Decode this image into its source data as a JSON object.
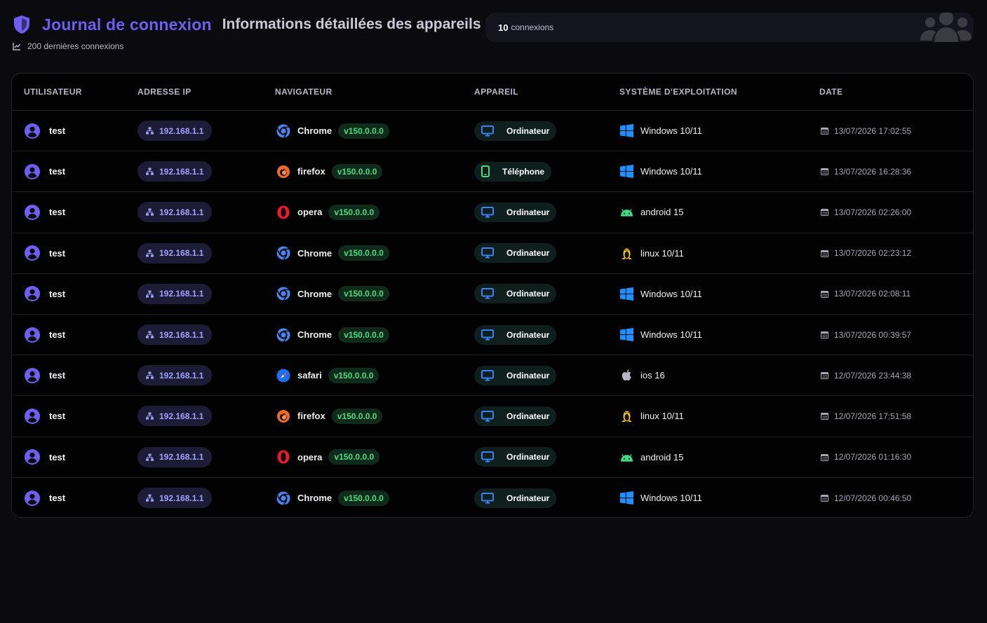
{
  "header": {
    "title": "Journal de connexion",
    "subtitle": "Informations détaillées des appareils",
    "count_value": "10",
    "count_label": "connexions",
    "recent_label": "200 dernières connexions",
    "accent_color": "#6f5ff0"
  },
  "table": {
    "columns": [
      "UTILISATEUR",
      "ADRESSE IP",
      "NAVIGATEUR",
      "APPAREIL",
      "SYSTÈME D'EXPLOITATION",
      "DATE"
    ],
    "rows": [
      {
        "user": "test",
        "ip": "192.168.1.1",
        "browser": "Chrome",
        "browser_icon": "chrome-icon",
        "version": "v150.0.0.0",
        "device": "Ordinateur",
        "device_icon": "desktop-icon",
        "os": "Windows 10/11",
        "os_icon": "windows-icon",
        "date": "13/07/2026 17:02:55"
      },
      {
        "user": "test",
        "ip": "192.168.1.1",
        "browser": "firefox",
        "browser_icon": "firefox-icon",
        "version": "v150.0.0.0",
        "device": "Téléphone",
        "device_icon": "phone-icon",
        "os": "Windows 10/11",
        "os_icon": "windows-icon",
        "date": "13/07/2026 16:28:36"
      },
      {
        "user": "test",
        "ip": "192.168.1.1",
        "browser": "opera",
        "browser_icon": "opera-icon",
        "version": "v150.0.0.0",
        "device": "Ordinateur",
        "device_icon": "desktop-icon",
        "os": "android 15",
        "os_icon": "android-icon",
        "date": "13/07/2026 02:26:00"
      },
      {
        "user": "test",
        "ip": "192.168.1.1",
        "browser": "Chrome",
        "browser_icon": "chrome-icon",
        "version": "v150.0.0.0",
        "device": "Ordinateur",
        "device_icon": "desktop-icon",
        "os": "linux 10/11",
        "os_icon": "linux-icon",
        "date": "13/07/2026 02:23:12"
      },
      {
        "user": "test",
        "ip": "192.168.1.1",
        "browser": "Chrome",
        "browser_icon": "chrome-icon",
        "version": "v150.0.0.0",
        "device": "Ordinateur",
        "device_icon": "desktop-icon",
        "os": "Windows 10/11",
        "os_icon": "windows-icon",
        "date": "13/07/2026 02:08:11"
      },
      {
        "user": "test",
        "ip": "192.168.1.1",
        "browser": "Chrome",
        "browser_icon": "chrome-icon",
        "version": "v150.0.0.0",
        "device": "Ordinateur",
        "device_icon": "desktop-icon",
        "os": "Windows 10/11",
        "os_icon": "windows-icon",
        "date": "13/07/2026 00:39:57"
      },
      {
        "user": "test",
        "ip": "192.168.1.1",
        "browser": "safari",
        "browser_icon": "safari-icon",
        "version": "v150.0.0.0",
        "device": "Ordinateur",
        "device_icon": "desktop-icon",
        "os": "ios 16",
        "os_icon": "apple-icon",
        "date": "12/07/2026 23:44:38"
      },
      {
        "user": "test",
        "ip": "192.168.1.1",
        "browser": "firefox",
        "browser_icon": "firefox-icon",
        "version": "v150.0.0.0",
        "device": "Ordinateur",
        "device_icon": "desktop-icon",
        "os": "linux 10/11",
        "os_icon": "linux-icon",
        "date": "12/07/2026 17:51:58"
      },
      {
        "user": "test",
        "ip": "192.168.1.1",
        "browser": "opera",
        "browser_icon": "opera-icon",
        "version": "v150.0.0.0",
        "device": "Ordinateur",
        "device_icon": "desktop-icon",
        "os": "android 15",
        "os_icon": "android-icon",
        "date": "12/07/2026 01:16:30"
      },
      {
        "user": "test",
        "ip": "192.168.1.1",
        "browser": "Chrome",
        "browser_icon": "chrome-icon",
        "version": "v150.0.0.0",
        "device": "Ordinateur",
        "device_icon": "desktop-icon",
        "os": "Windows 10/11",
        "os_icon": "windows-icon",
        "date": "12/07/2026 00:46:50"
      }
    ]
  }
}
